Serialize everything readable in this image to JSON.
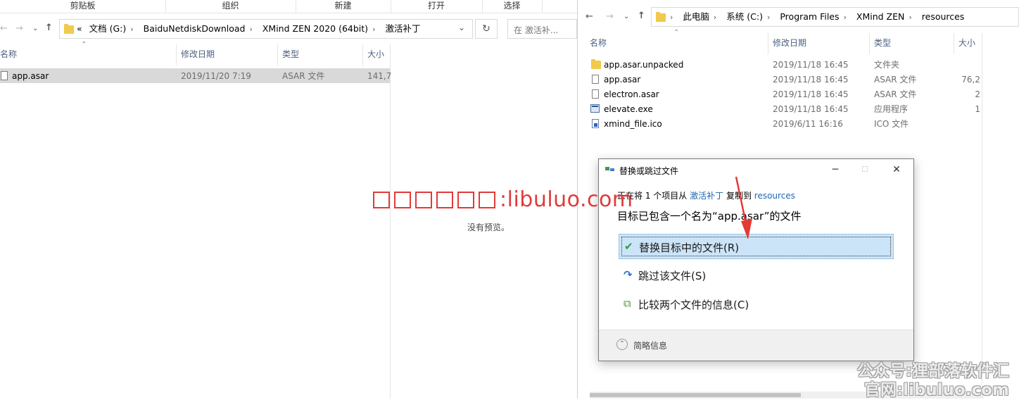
{
  "left_window": {
    "ribbon_groups": [
      "剪贴板",
      "组织",
      "新建",
      "打开",
      "选择"
    ],
    "address": {
      "prefix": "«",
      "crumbs": [
        "文档 (G:)",
        "BaiduNetdiskDownload",
        "XMind ZEN 2020 (64bit)",
        "激活补丁"
      ]
    },
    "search_placeholder": "在 激活补...",
    "columns": [
      "名称",
      "修改日期",
      "类型",
      "大小"
    ],
    "files": [
      {
        "name": "app.asar",
        "date": "2019/11/20 7:19",
        "type": "ASAR 文件",
        "size": "141,7"
      }
    ],
    "preview_text": "没有预览。"
  },
  "right_window": {
    "address": {
      "crumbs": [
        "此电脑",
        "系统 (C:)",
        "Program Files",
        "XMind ZEN",
        "resources"
      ]
    },
    "columns": [
      "名称",
      "修改日期",
      "类型",
      "大小"
    ],
    "files": [
      {
        "name": "app.asar.unpacked",
        "date": "2019/11/18 16:45",
        "type": "文件夹",
        "size": "",
        "icon": "folder-icon"
      },
      {
        "name": "app.asar",
        "date": "2019/11/18 16:45",
        "type": "ASAR 文件",
        "size": "76,2",
        "icon": "file-icon"
      },
      {
        "name": "electron.asar",
        "date": "2019/11/18 16:45",
        "type": "ASAR 文件",
        "size": "2",
        "icon": "file-icon"
      },
      {
        "name": "elevate.exe",
        "date": "2019/11/18 16:45",
        "type": "应用程序",
        "size": "1",
        "icon": "exe-icon"
      },
      {
        "name": "xmind_file.ico",
        "date": "2019/6/11 16:16",
        "type": "ICO 文件",
        "size": "",
        "icon": "ico-file-icon"
      }
    ]
  },
  "dialog": {
    "title": "替换或跳过文件",
    "info_prefix": "正在将 1 个项目从",
    "info_source": "激活补丁",
    "info_middle": "复制到",
    "info_dest": "resources",
    "message": "目标已包含一个名为“app.asar”的文件",
    "options": [
      {
        "label": "替换目标中的文件(R)",
        "icon": "checkmark-icon"
      },
      {
        "label": "跳过该文件(S)",
        "icon": "skip-arrow-icon"
      },
      {
        "label": "比较两个文件的信息(C)",
        "icon": "compare-icon"
      }
    ],
    "details_label": "简略信息"
  },
  "watermarks": {
    "red_text": ":libuluo.com",
    "line1": "公众号:狸部落软件汇",
    "line2": "官网:libuluo.com"
  },
  "colors": {
    "selection_blue": "#cce4f7",
    "link_blue": "#1e67b3",
    "arrow_red": "#e53935"
  }
}
